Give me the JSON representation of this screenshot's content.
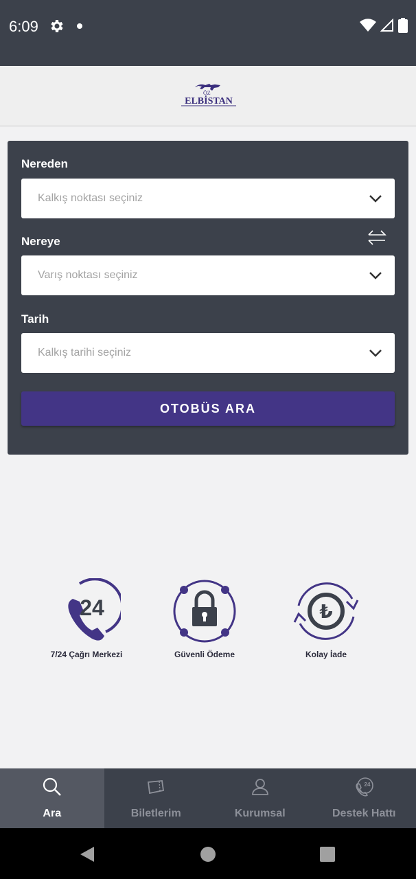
{
  "status_bar": {
    "time": "6:09"
  },
  "header": {
    "logo_top": "ÖZ",
    "logo_main": "ELBİSTAN"
  },
  "search": {
    "from_label": "Nereden",
    "from_placeholder": "Kalkış noktası seçiniz",
    "to_label": "Nereye",
    "to_placeholder": "Varış noktası seçiniz",
    "date_label": "Tarih",
    "date_placeholder": "Kalkış tarihi seçiniz",
    "button_label": "OTOBÜS ARA"
  },
  "features": [
    {
      "label": "7/24 Çağrı Merkezi",
      "badge": "24",
      "icon": "phone-24-icon"
    },
    {
      "label": "Güvenli Ödeme",
      "icon": "padlock-icon"
    },
    {
      "label": "Kolay İade",
      "badge": "₺",
      "icon": "lira-refund-icon"
    }
  ],
  "bottom_nav": [
    {
      "label": "Ara",
      "icon": "search-icon",
      "active": true
    },
    {
      "label": "Biletlerim",
      "icon": "ticket-icon",
      "active": false
    },
    {
      "label": "Kurumsal",
      "icon": "user-icon",
      "active": false
    },
    {
      "label": "Destek Hattı",
      "icon": "support-phone-icon",
      "badge": "24",
      "active": false
    }
  ],
  "colors": {
    "primary_purple": "#433586",
    "dark_panel": "#3c414b",
    "active_tab": "#545862",
    "background": "#f2f2f3"
  }
}
